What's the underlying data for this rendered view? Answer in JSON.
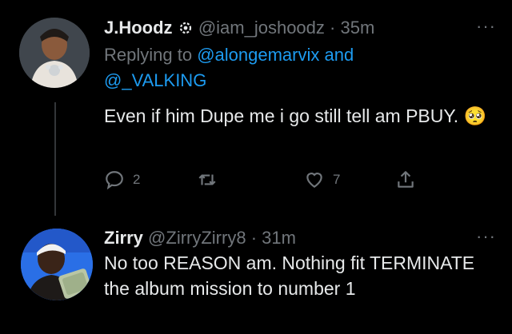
{
  "tweets": [
    {
      "display_name": "J.Hoodz",
      "handle": "@iam_joshoodz",
      "separator": "·",
      "time": "35m",
      "replying_prefix": "Replying to",
      "mention_1": "@alongemarvix",
      "mention_join": "and",
      "mention_2": "@_VALKING",
      "text": "Even if him Dupe me i go still tell am PBUY.",
      "emoji": "🥺",
      "reply_count": "2",
      "like_count": "7",
      "more": "···"
    },
    {
      "display_name": "Zirry",
      "handle": "@ZirryZirry8",
      "separator": "·",
      "time": "31m",
      "text": "No too REASON am. Nothing fit TERMINATE the album mission to number 1",
      "more": "···"
    }
  ],
  "colors": {
    "background": "#000000",
    "text": "#e7e9ea",
    "muted": "#71767b",
    "link": "#1d9bf0"
  },
  "icons": [
    "reply-icon",
    "retweet-icon",
    "like-icon",
    "share-icon",
    "settings-badge-icon"
  ]
}
